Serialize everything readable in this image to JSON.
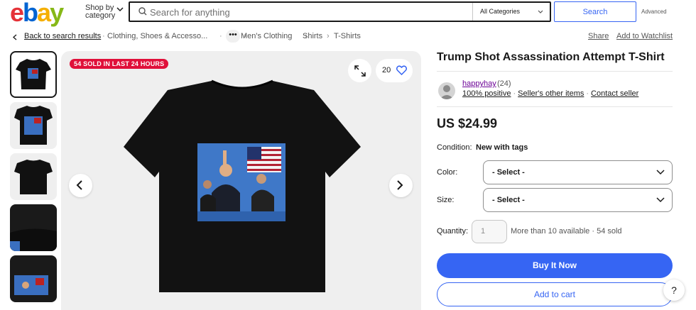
{
  "header": {
    "logo": {
      "e": "e",
      "b": "b",
      "a": "a",
      "y": "y"
    },
    "shop_by": "Shop by",
    "shop_by_2": "category",
    "search_placeholder": "Search for anything",
    "category_selected": "All Categories",
    "search_button": "Search",
    "advanced": "Advanced"
  },
  "breadcrumb": {
    "back": "Back to search results",
    "items": [
      "Clothing, Shoes & Accesso...",
      "Men's Clothing",
      "Shirts",
      "T-Shirts"
    ],
    "more": "•••",
    "share": "Share",
    "watchlist": "Add to Watchlist"
  },
  "gallery": {
    "badge": "54 SOLD IN LAST 24 HOURS",
    "watchers": "20"
  },
  "product": {
    "title": "Trump Shot Assassination Attempt T-Shirt",
    "price": "US $24.99",
    "condition_label": "Condition:",
    "condition_value": "New with tags",
    "color_label": "Color:",
    "color_value": "- Select -",
    "size_label": "Size:",
    "size_value": "- Select -",
    "quantity_label": "Quantity:",
    "quantity_value": "1",
    "availability": "More than 10 available · 54 sold",
    "buy_now": "Buy It Now",
    "add_to_cart": "Add to cart"
  },
  "seller": {
    "name": "happyhay",
    "count": "(24)",
    "positive": "100% positive",
    "other_items": "Seller's other items",
    "contact": "Contact seller"
  },
  "help": "?",
  "colors": {
    "accent": "#3665f3",
    "sold_badge": "#e0103a",
    "seller_link": "#6b0096"
  }
}
